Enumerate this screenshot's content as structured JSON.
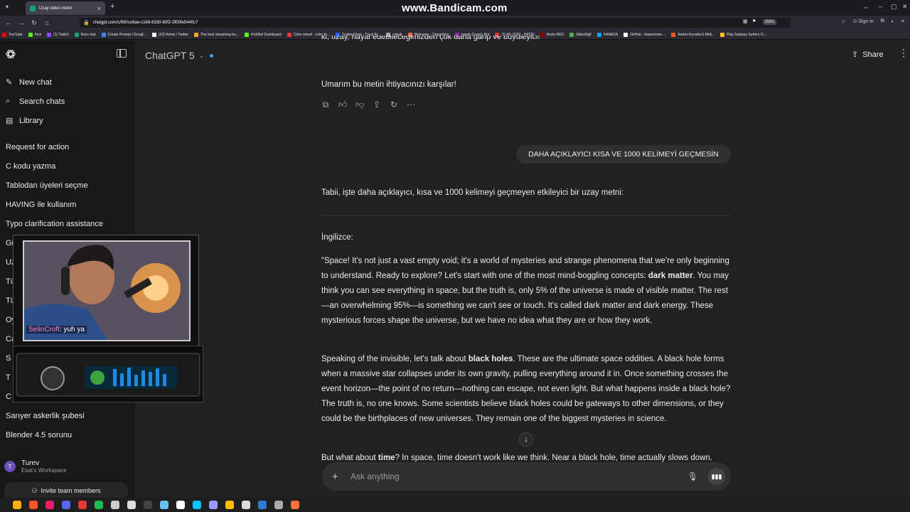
{
  "browser": {
    "tab_title": "Uzay video metni",
    "url": "chatgpt.com/c/690ce8ae-c168-8330-80f2-3f00fe5440c7",
    "zoom": "150%",
    "watermark": "www.Bandicam.com",
    "sign_in": "Sign in"
  },
  "bookmarks": [
    {
      "label": "YouTube",
      "color": "#ff0000"
    },
    {
      "label": "Kick",
      "color": "#53fc18"
    },
    {
      "label": "(1) Twitch",
      "color": "#9146ff"
    },
    {
      "label": "New chat",
      "color": "#10a37f"
    },
    {
      "label": "Create Prompt | Googl...",
      "color": "#4285f4"
    },
    {
      "label": "(10) Home / Twitter",
      "color": "#ffffff"
    },
    {
      "label": "The best streaming bo...",
      "color": "#f5a623"
    },
    {
      "label": "KickBot Dashboard",
      "color": "#53fc18"
    },
    {
      "label": "Color wheel - color th...",
      "color": "#e53935"
    },
    {
      "label": "TradingView - Track Al...",
      "color": "#2962ff"
    },
    {
      "label": "cobalt",
      "color": "#aaaaaa"
    },
    {
      "label": "Welcome - Triggerfyre",
      "color": "#ff7043"
    },
    {
      "label": "Isaiah Great's Bot",
      "color": "#9c27b0"
    },
    {
      "label": "70.4% (226) - HAYIR",
      "color": "#e53935"
    },
    {
      "label": "Node-RED",
      "color": "#8f0000"
    },
    {
      "label": "3dtext2gif",
      "color": "#4caf50"
    },
    {
      "label": "KANADA",
      "color": "#03a9f4"
    },
    {
      "label": "GitHub - Itawesome-...",
      "color": "#ffffff"
    },
    {
      "label": "Andrei Kovalev's Midi...",
      "color": "#ff5722"
    },
    {
      "label": "Play Subway Surfers O...",
      "color": "#ffc107"
    }
  ],
  "sidebar": {
    "nav": [
      {
        "icon": "new-chat-icon",
        "glyph": "✎",
        "label": "New chat"
      },
      {
        "icon": "search-icon",
        "glyph": "⌕",
        "label": "Search chats"
      },
      {
        "icon": "library-icon",
        "glyph": "▤",
        "label": "Library"
      }
    ],
    "chats": [
      "Request for action",
      "C kodu yazma",
      "Tablodan üyeleri seçme",
      "HAVING ile kullanım",
      "Typo clarification assistance",
      "Gr",
      "Uza",
      "Tür",
      "Tür",
      "Oyu",
      "Ca",
      "S",
      "T",
      "C",
      "Sarıyer askerlik şubesi",
      "Blender 4.5 sorunu"
    ],
    "user": {
      "name": "Turev",
      "workspace": "Esat's Workspace",
      "initial": "T"
    },
    "invite_label": "Invite team members"
  },
  "header": {
    "model": "ChatGPT 5",
    "share_label": "Share"
  },
  "conversation": {
    "cut_line": "ki, uzay, hayal edebileceğimizden çok daha garip ve büyüleyici!",
    "closing": "Umarım bu metin ihtiyacınızı karşılar!",
    "user_message": "DAHA AÇIKLAYICI KISA VE 1000 KELİMEYİ GEÇMESİN",
    "intro": "Tabii, işte daha açıklayıcı, kısa ve 1000 kelimeyi geçmeyen etkileyici bir uzay metni:",
    "lang_heading": "İngilizce:",
    "para1_a": "\"Space! It's not just a vast empty void; it's a world of mysteries and strange phenomena that we're only beginning to understand. Ready to explore? Let's start with one of the most mind-boggling concepts: ",
    "para1_bold": "dark matter",
    "para1_b": ". You may think you can see everything in space, but the truth is, only 5% of the universe is made of visible matter. The rest—an overwhelming 95%—is something we can't see or touch. It's called dark matter and dark energy. These mysterious forces shape the universe, but we have no idea what they are or how they work.",
    "para2_a": "Speaking of the invisible, let's talk about ",
    "para2_bold": "black holes",
    "para2_b": ". These are the ultimate space oddities. A black hole forms when a massive star collapses under its own gravity, pulling everything around it in. Once something crosses the event horizon—the point of no return—nothing can escape, not even light. But what happens inside a black hole? The truth is, no one knows. Some scientists believe black holes could be gateways to other dimensions, or they could be the birthplaces of new universes. They remain one of the biggest mysteries in science.",
    "para3_a": "But what about ",
    "para3_bold": "time",
    "para3_b": "? In space, time doesn't work like we think. Near a black hole, time actually slows down."
  },
  "composer": {
    "placeholder": "Ask anything"
  },
  "overlay": {
    "chat_user": "SelinCroft",
    "chat_text": ": yuh ya"
  },
  "taskbar_colors": [
    "#ffb300",
    "#fb542b",
    "#e91e63",
    "#5865f2",
    "#e53935",
    "#1db954",
    "#cccccc",
    "#dddddd",
    "#444444",
    "#66c0f4",
    "#ffffff",
    "#00c3ff",
    "#9999ff",
    "#ffbf00",
    "#dddddd",
    "#2b7cd3",
    "#aaaaaa",
    "#ff7139"
  ]
}
